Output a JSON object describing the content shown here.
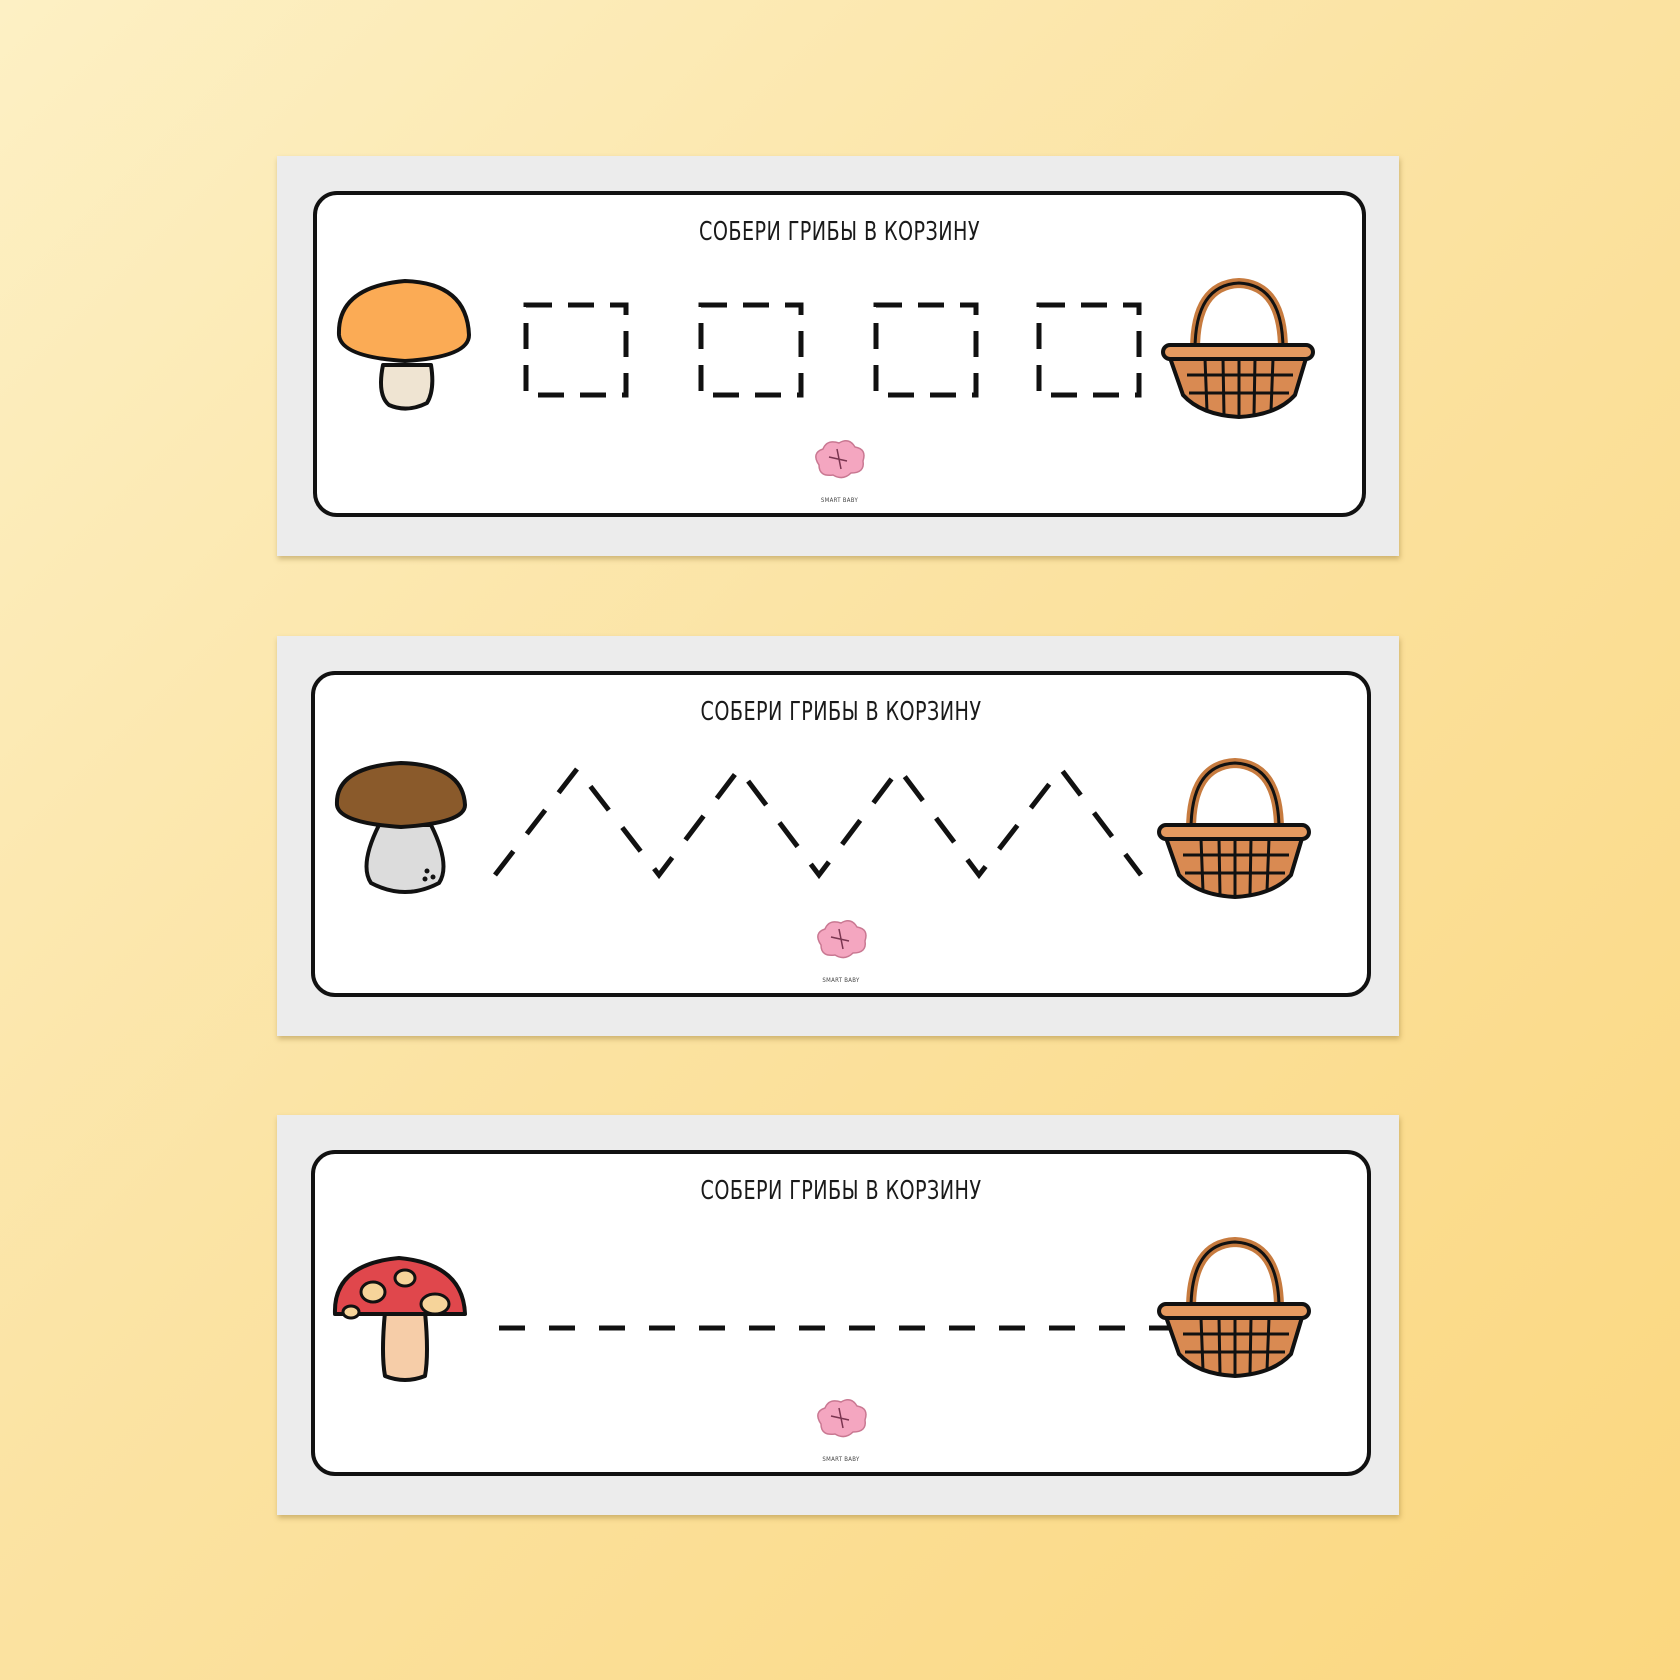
{
  "cards": [
    {
      "title": "СОБЕРИ ГРИБЫ В КОРЗИНУ",
      "mushroom": "orange-cap-mushroom-icon",
      "path": "dashed-squares",
      "brand": "SMART BABY"
    },
    {
      "title": "СОБЕРИ ГРИБЫ В КОРЗИНУ",
      "mushroom": "porcini-mushroom-icon",
      "path": "dashed-zigzag",
      "brand": "SMART BABY"
    },
    {
      "title": "СОБЕРИ ГРИБЫ В КОРЗИНУ",
      "mushroom": "fly-agaric-mushroom-icon",
      "path": "dashed-straight-line",
      "brand": "SMART BABY"
    }
  ],
  "colors": {
    "background": "#fbe3a3",
    "orange_cap": "#fbab55",
    "brown_cap": "#8a5a2b",
    "red_cap": "#e0474c",
    "basket": "#d98a52",
    "outline": "#111111",
    "brand_pink": "#f4a6c0"
  }
}
